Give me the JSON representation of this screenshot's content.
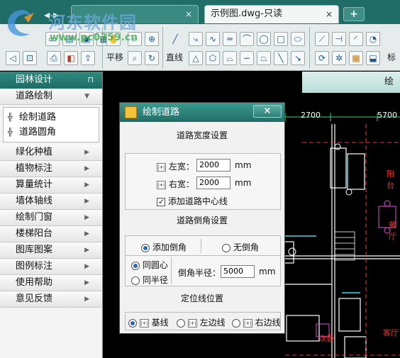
{
  "tabs": [
    {
      "label": "",
      "active": false
    },
    {
      "label": "示例图.dwg-只读",
      "active": true
    }
  ],
  "add_tab_label": "+",
  "close_glyph": "×",
  "watermark": {
    "title": "河东软件园",
    "url": "www.pc0359.cn"
  },
  "toolbar": {
    "pan_label": "平移",
    "line_label": "直线",
    "mark_label": "标"
  },
  "panel": {
    "header": "园林设计",
    "pin_glyph": "⊓",
    "open_section": "道路绘制",
    "sub_items": [
      "绘制道路",
      "道路圆角"
    ],
    "items": [
      "绿化种植",
      "植物标注",
      "算量统计",
      "墙体轴线",
      "绘制门窗",
      "楼梯阳台",
      "图库图案",
      "图例标注",
      "使用帮助",
      "意见反馈"
    ]
  },
  "cad": {
    "tab_label": "绘",
    "dims": [
      "2700",
      "5700"
    ],
    "room_labels": [
      "阳台",
      "餐厅",
      "次卧",
      "客厅"
    ]
  },
  "dialog": {
    "title": "绘制道路",
    "close_glyph": "×",
    "width_section": "道路宽度设置",
    "left_width_label": "左宽：",
    "left_width_value": "2000",
    "right_width_label": "右宽：",
    "right_width_value": "2000",
    "unit": "mm",
    "add_centerline_label": "添加道路中心线",
    "add_centerline_checked": true,
    "chamfer_section": "道路倒角设置",
    "add_chamfer_label": "添加倒角",
    "no_chamfer_label": "无倒角",
    "concentric_label": "同圆心",
    "same_radius_label": "同半径",
    "radius_label": "倒角半径：",
    "radius_value": "5000",
    "position_section": "定位线位置",
    "baseline_label": "基线",
    "left_edge_label": "左边线",
    "right_edge_label": "右边线"
  }
}
